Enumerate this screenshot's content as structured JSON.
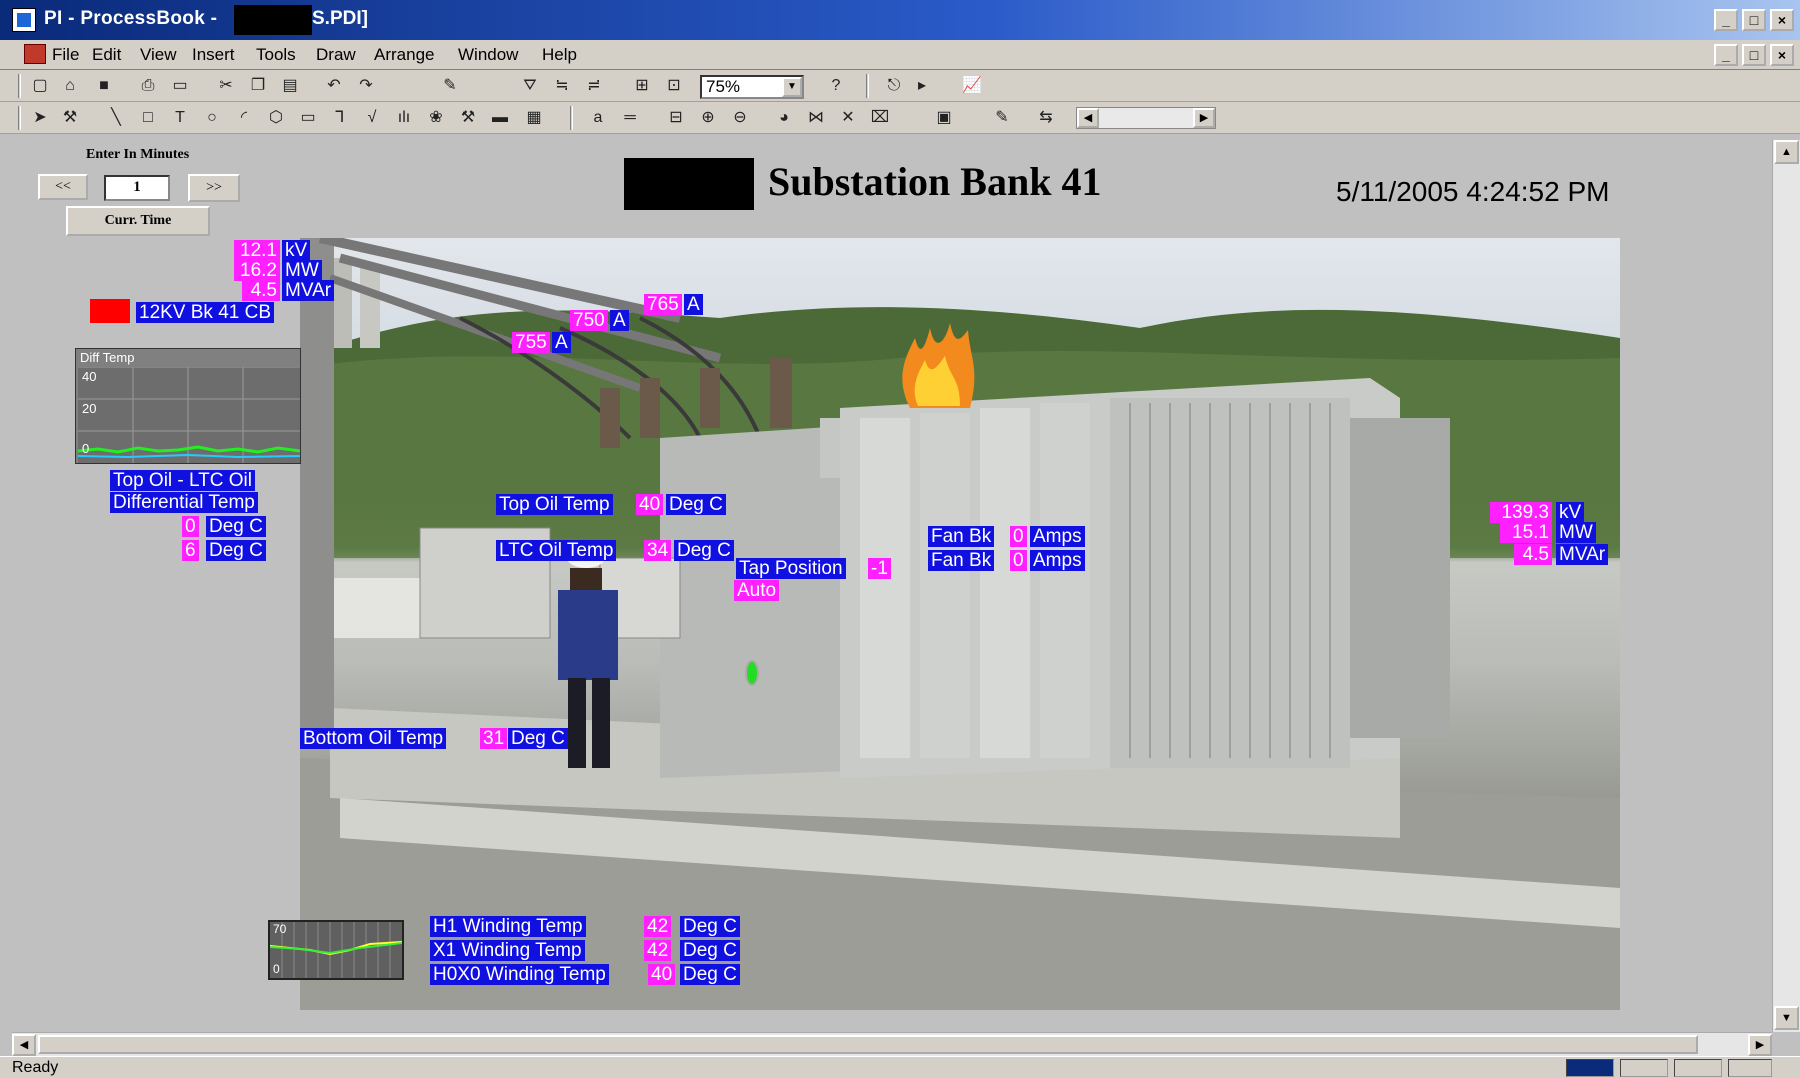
{
  "window": {
    "title_prefix": "PI - ProcessBook -",
    "title_suffix": "S.PDI]",
    "minimize": "_",
    "maximize": "□",
    "close": "×",
    "restore": "🗗"
  },
  "menu": [
    "File",
    "Edit",
    "View",
    "Insert",
    "Tools",
    "Draw",
    "Arrange",
    "Window",
    "Help"
  ],
  "toolbar": {
    "zoom": "75%"
  },
  "controls": {
    "enter_label": "Enter In Minutes",
    "prev": "<<",
    "minutes": "1",
    "next": ">>",
    "curr_time": "Curr. Time"
  },
  "header": {
    "title": "Substation Bank 41",
    "datetime": "5/11/2005 4:24:52 PM"
  },
  "left_feed": {
    "kv": "12.1",
    "kv_unit": "kV",
    "mw": "16.2",
    "mw_unit": "MW",
    "mvar": "4.5",
    "mvar_unit": "MVAr",
    "breaker_label": "12KV Bk 41 CB"
  },
  "currents": [
    {
      "value": "765",
      "unit": "A"
    },
    {
      "value": "750",
      "unit": "A"
    },
    {
      "value": "755",
      "unit": "A"
    }
  ],
  "diff_trend": {
    "title": "Diff Temp",
    "ticks": [
      "40",
      "20",
      "0"
    ]
  },
  "diff_labels": {
    "line1": "Top Oil - LTC Oil",
    "line2": "Differential Temp",
    "val1": "0",
    "val2": "6",
    "unit": "Deg C"
  },
  "temps": {
    "top_oil_label": "Top Oil Temp",
    "top_oil_value": "40",
    "ltc_oil_label": "LTC Oil Temp",
    "ltc_oil_value": "34",
    "bottom_oil_label": "Bottom Oil Temp",
    "bottom_oil_value": "31",
    "unit": "Deg C"
  },
  "tap": {
    "label": "Tap Position",
    "value": "-1",
    "mode": "Auto"
  },
  "fans": [
    {
      "label": "Fan Bk",
      "value": "0",
      "unit": "Amps"
    },
    {
      "label": "Fan Bk",
      "value": "0",
      "unit": "Amps"
    }
  ],
  "right_feed": {
    "kv": "139.3",
    "kv_unit": "kV",
    "mw": "15.1",
    "mw_unit": "MW",
    "mvar": "4.5",
    "mvar_unit": "MVAr"
  },
  "winding_trend": {
    "ticks": [
      "70",
      "0"
    ]
  },
  "windings": [
    {
      "label": "H1 Winding Temp",
      "value": "42",
      "unit": "Deg C"
    },
    {
      "label": "X1 Winding Temp",
      "value": "42",
      "unit": "Deg C"
    },
    {
      "label": "H0X0 Winding Temp",
      "value": "40",
      "unit": "Deg C"
    }
  ],
  "status": {
    "text": "Ready"
  },
  "colors": {
    "label_bg": "#1010e0",
    "value_bg": "#ff20ff",
    "breaker": "#ff0000",
    "indicator": "#22dd22"
  }
}
